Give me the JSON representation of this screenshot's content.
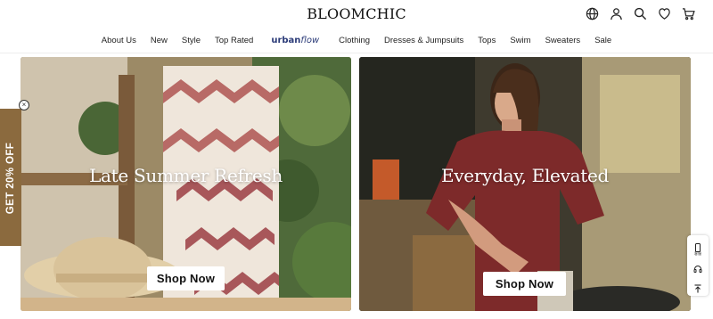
{
  "header": {
    "logo": "BLOOMCHIC",
    "icons": [
      "globe-icon",
      "account-icon",
      "search-icon",
      "heart-icon",
      "cart-icon"
    ]
  },
  "nav": {
    "items": [
      "About Us",
      "New",
      "Style",
      "Top Rated"
    ],
    "brand_part1": "urban",
    "brand_part2": "flow",
    "items_after": [
      "Clothing",
      "Dresses & Jumpsuits",
      "Tops",
      "Swim",
      "Sweaters",
      "Sale"
    ]
  },
  "heroes": [
    {
      "title": "Late Summer Refresh",
      "cta": "Shop Now"
    },
    {
      "title": "Everyday, Elevated",
      "cta": "Shop Now"
    }
  ],
  "promo": {
    "label": "GET 20% OFF",
    "close": "×"
  },
  "widget": {
    "label": "客服"
  },
  "colors": {
    "brand": "#2b3b78",
    "promo": "#8b6a3e",
    "accent_stripe": "#b86a66",
    "top_burgundy": "#7d2a2a"
  }
}
